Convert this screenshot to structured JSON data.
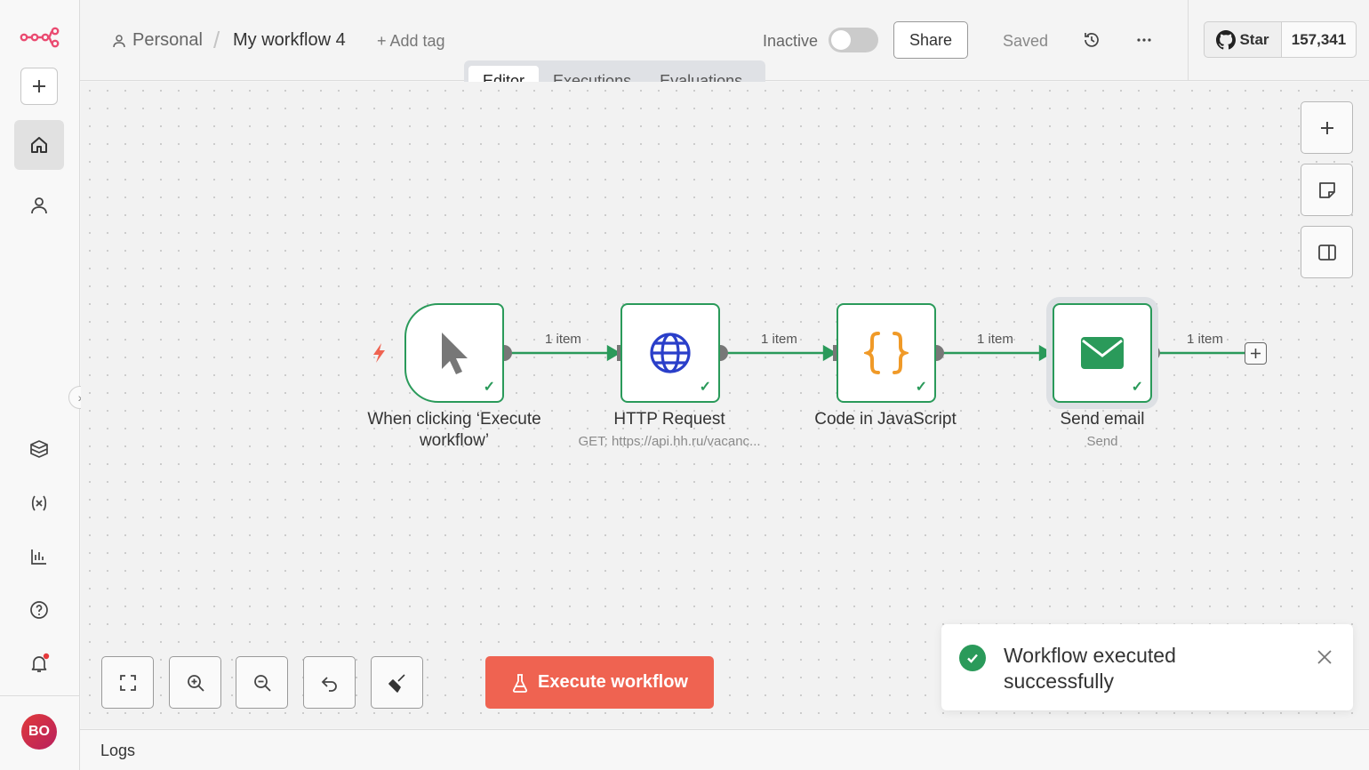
{
  "breadcrumb": {
    "project": "Personal",
    "separator": "/",
    "workflow_name": "My workflow 4",
    "add_tag": "+ Add tag"
  },
  "header": {
    "status_label": "Inactive",
    "share_label": "Share",
    "saved_label": "Saved",
    "github_star_label": "Star",
    "github_star_count": "157,341"
  },
  "tabs": [
    {
      "label": "Editor",
      "active": true
    },
    {
      "label": "Executions",
      "active": false
    },
    {
      "label": "Evaluations",
      "active": false
    }
  ],
  "nodes": [
    {
      "label": "When clicking ‘Execute workflow’",
      "subtitle": "",
      "icon": "cursor-icon"
    },
    {
      "label": "HTTP Request",
      "subtitle": "GET: https://api.hh.ru/vacanc...",
      "icon": "globe-icon"
    },
    {
      "label": "Code in JavaScript",
      "subtitle": "",
      "icon": "braces-icon"
    },
    {
      "label": "Send email",
      "subtitle": "Send",
      "icon": "envelope-icon"
    }
  ],
  "edges": [
    {
      "label": "1 item"
    },
    {
      "label": "1 item"
    },
    {
      "label": "1 item"
    },
    {
      "label": "1 item"
    }
  ],
  "execute_button": {
    "label": "Execute workflow"
  },
  "toast": {
    "message": "Workflow executed successfully"
  },
  "logs": {
    "label": "Logs"
  },
  "user": {
    "initials": "BO"
  },
  "colors": {
    "success": "#2a9a5a",
    "execute": "#ef6351",
    "brand": "#ea4b71",
    "code": "#f09a28",
    "http": "#2a3fc9"
  }
}
